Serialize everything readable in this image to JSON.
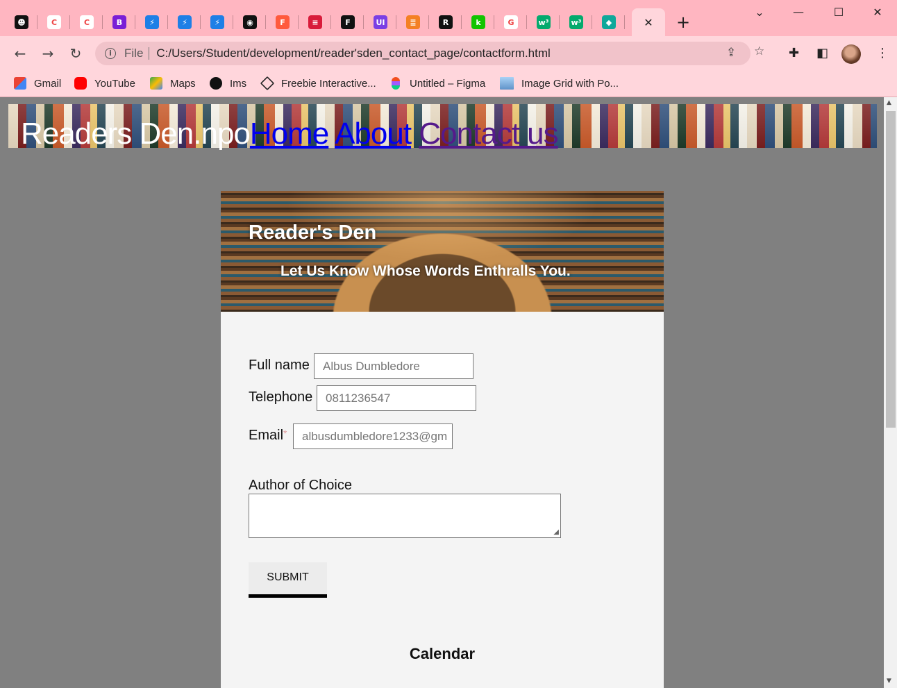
{
  "browser": {
    "tabs": [
      {
        "icon": "openmoji-icon",
        "bg": "#111111",
        "glyph": "☻"
      },
      {
        "icon": "clickup-icon",
        "bg": "#ffffff",
        "glyph": "C"
      },
      {
        "icon": "clickup-icon",
        "bg": "#ffffff",
        "glyph": "C"
      },
      {
        "icon": "bootstrap-icon",
        "bg": "#7a1fd6",
        "glyph": "B"
      },
      {
        "icon": "bolt-icon",
        "bg": "#1e7fe6",
        "glyph": "⚡"
      },
      {
        "icon": "bolt-icon",
        "bg": "#1e7fe6",
        "glyph": "⚡"
      },
      {
        "icon": "bolt-icon",
        "bg": "#1e7fe6",
        "glyph": "⚡"
      },
      {
        "icon": "github-icon",
        "bg": "#111111",
        "glyph": "◉"
      },
      {
        "icon": "figma-icon",
        "bg": "#ff5a3d",
        "glyph": "F"
      },
      {
        "icon": "flash-cards-icon",
        "bg": "#d81b3a",
        "glyph": "≡"
      },
      {
        "icon": "f-icon",
        "bg": "#111111",
        "glyph": "F"
      },
      {
        "icon": "ui-icon",
        "bg": "#7b3fe4",
        "glyph": "UI"
      },
      {
        "icon": "stackoverflow-icon",
        "bg": "#f48024",
        "glyph": "≣"
      },
      {
        "icon": "r-icon",
        "bg": "#111111",
        "glyph": "R"
      },
      {
        "icon": "k-icon",
        "bg": "#12c400",
        "glyph": "k"
      },
      {
        "icon": "google-icon",
        "bg": "#ffffff",
        "glyph": "G"
      },
      {
        "icon": "w3-icon",
        "bg": "#04aa6d",
        "glyph": "w³"
      },
      {
        "icon": "w3-icon",
        "bg": "#04aa6d",
        "glyph": "w³"
      },
      {
        "icon": "diamond-icon",
        "bg": "#0fa89a",
        "glyph": "◆"
      }
    ],
    "active_tab_close": "✕",
    "new_tab": "+",
    "address": {
      "scheme": "File",
      "url": "C:/Users/Student/development/reader'sden_contact_page/contactform.html"
    },
    "bookmarks": [
      {
        "label": "Gmail",
        "icon": "gmail-icon",
        "color": "#ea4335"
      },
      {
        "label": "YouTube",
        "icon": "youtube-icon",
        "color": "#ff0000"
      },
      {
        "label": "Maps",
        "icon": "maps-icon",
        "color": "#34a853"
      },
      {
        "label": "Ims",
        "icon": "openmoji-icon",
        "color": "#111111"
      },
      {
        "label": "Freebie Interactive...",
        "icon": "codepen-icon",
        "color": "#222222"
      },
      {
        "label": "Untitled – Figma",
        "icon": "figma-icon",
        "color": "#ff5a3d"
      },
      {
        "label": "Image Grid with Po...",
        "icon": "image-icon",
        "color": "#7fb3e0"
      }
    ]
  },
  "page": {
    "nav": {
      "brand": "Readers Den.npo",
      "home": "Home",
      "about": "About",
      "contact": "Contact us"
    },
    "hero": {
      "title": "Reader's Den",
      "subtitle": "Let Us Know Whose Words Enthralls You."
    },
    "form": {
      "full_name": {
        "label": "Full name",
        "placeholder": "Albus Dumbledore"
      },
      "telephone": {
        "label": "Telephone",
        "placeholder": "0811236547"
      },
      "email": {
        "label": "Email",
        "required_mark": "*",
        "placeholder": "albusdumbledore1233@gm"
      },
      "author": {
        "label": "Author of Choice"
      },
      "submit": "SUBMIT"
    },
    "calendar_heading": "Calendar"
  }
}
